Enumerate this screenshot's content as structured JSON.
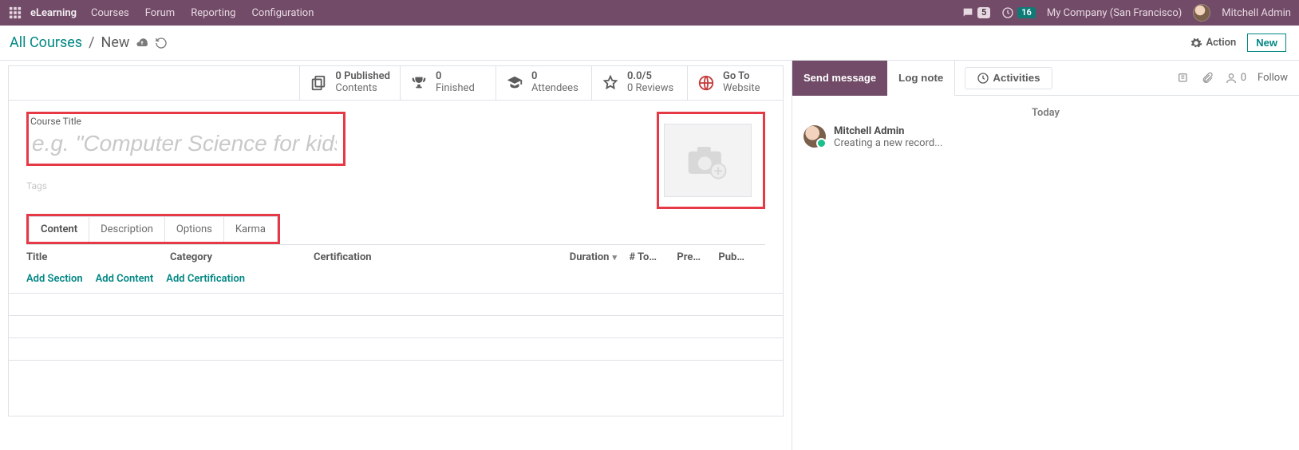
{
  "topbar": {
    "brand": "eLearning",
    "menu": [
      "Courses",
      "Forum",
      "Reporting",
      "Configuration"
    ],
    "discuss_badge": "5",
    "activity_badge": "16",
    "company": "My Company (San Francisco)",
    "user": "Mitchell Admin"
  },
  "breadcrumb": {
    "root": "All Courses",
    "leaf": "New"
  },
  "subheader": {
    "action_label": "Action",
    "new_label": "New"
  },
  "statbar": {
    "published": {
      "line1": "0 Published",
      "line2": "Contents"
    },
    "finished": {
      "line1": "0",
      "line2": "Finished"
    },
    "attendees": {
      "line1": "0",
      "line2": "Attendees"
    },
    "reviews": {
      "line1": "0.0/5",
      "line2": "0 Reviews"
    },
    "website": {
      "line1": "Go To",
      "line2": "Website"
    }
  },
  "form": {
    "course_title_label": "Course Title",
    "course_title_placeholder": "e.g. \"Computer Science for kids\"",
    "tags_label": "Tags"
  },
  "tabs": {
    "items": [
      "Content",
      "Description",
      "Options",
      "Karma"
    ],
    "active_index": 0
  },
  "content_table": {
    "columns": {
      "title": "Title",
      "category": "Category",
      "certification": "Certification",
      "duration": "Duration",
      "total": "# To…",
      "preview": "Pre…",
      "publish": "Pub…"
    },
    "links": {
      "add_section": "Add Section",
      "add_content": "Add Content",
      "add_certification": "Add Certification"
    }
  },
  "chatter": {
    "send_label": "Send message",
    "lognote_label": "Log note",
    "activities_label": "Activities",
    "followers_count": "0",
    "follow_label": "Follow",
    "today_label": "Today",
    "entry": {
      "author": "Mitchell Admin",
      "text": "Creating a new record..."
    }
  }
}
